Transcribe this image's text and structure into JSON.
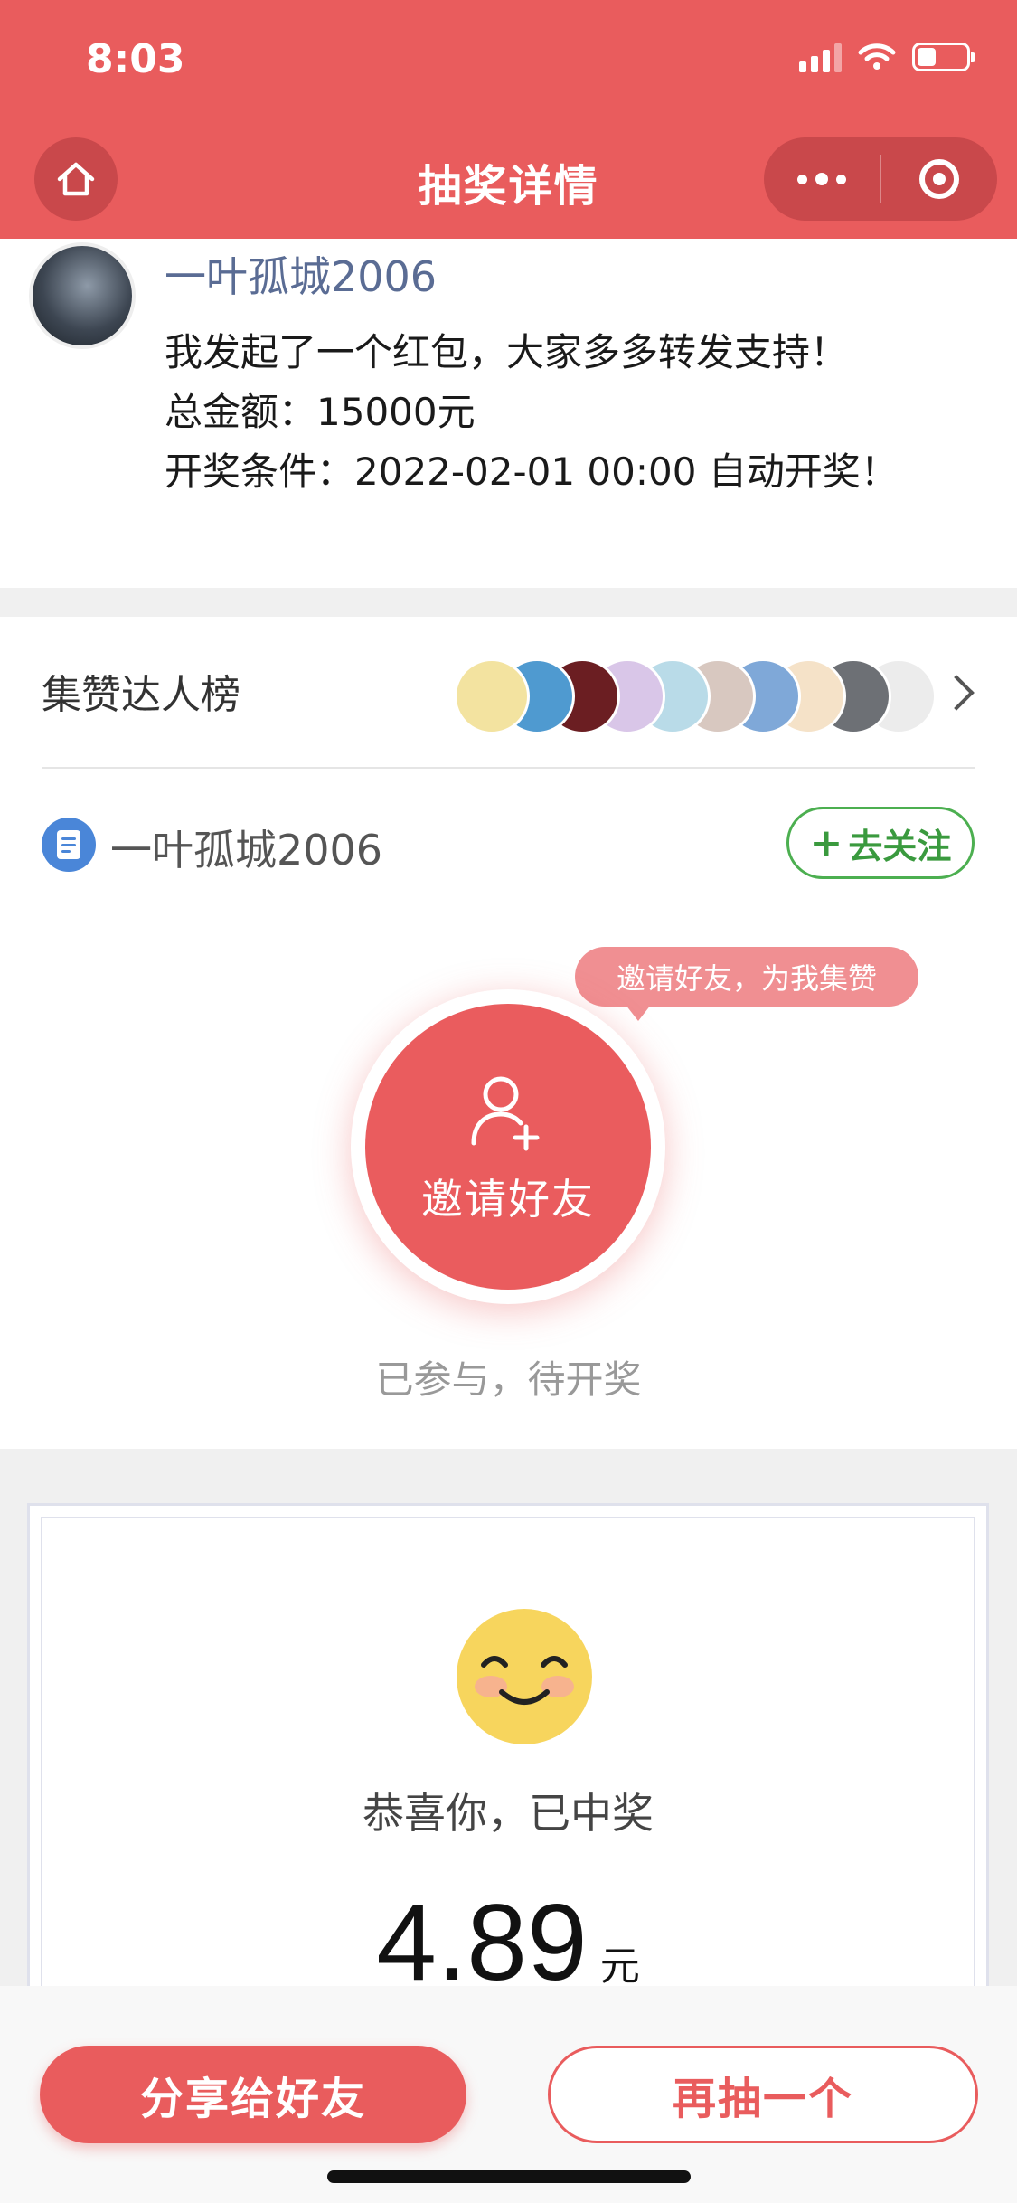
{
  "status_bar": {
    "time": "8:03"
  },
  "nav": {
    "title": "抽奖详情"
  },
  "post": {
    "author": "一叶孤城2006",
    "message": "我发起了一个红包，大家多多转发支持！",
    "total": "总金额：15000元",
    "condition": "开奖条件：2022-02-01 00:00 自动开奖！"
  },
  "ranking": {
    "label": "集赞达人榜",
    "avatars": [
      "#f3e3a0",
      "#4f9ad0",
      "#6b1e22",
      "#d9c6e8",
      "#b9dbe8",
      "#d8c8c0",
      "#7fa8d8",
      "#f5e2c8",
      "#6d7075",
      "#ececec"
    ]
  },
  "account": {
    "name": "一叶孤城2006",
    "follow_label": "去关注"
  },
  "invite": {
    "tooltip": "邀请好友，为我集赞",
    "button_label": "邀请好友",
    "status": "已参与，待开奖"
  },
  "prize": {
    "message": "恭喜你，已中奖",
    "amount": "4.89",
    "unit": "元"
  },
  "actions": {
    "share_label": "分享给好友",
    "again_label": "再抽一个"
  },
  "colors": {
    "brand": "#e95c5d",
    "follow": "#4caf50",
    "link_name": "#5a6c94"
  }
}
